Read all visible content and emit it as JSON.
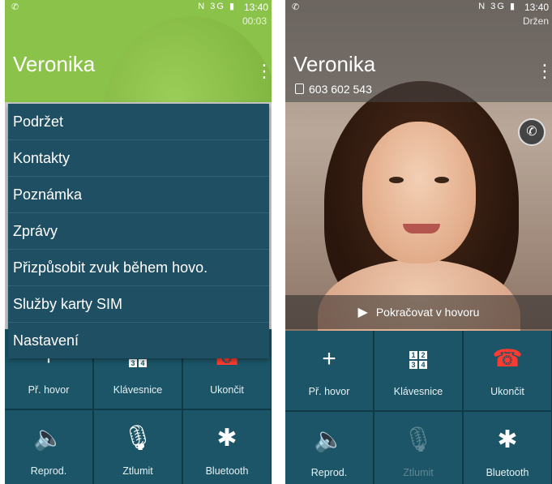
{
  "left": {
    "status_bar": {
      "time": "13:40",
      "network": "3G"
    },
    "call": {
      "duration": "00:03",
      "caller": "Veronika"
    },
    "menu": {
      "items": [
        "Podržet",
        "Kontakty",
        "Poznámka",
        "Zprávy",
        "Přizpůsobit zvuk během hovo.",
        "Služby karty SIM",
        "Nastavení"
      ]
    },
    "buttons": {
      "add_call": "Př. hovor",
      "keypad": "Klávesnice",
      "end": "Ukončit",
      "speaker": "Reprod.",
      "mute": "Ztlumit",
      "bluetooth": "Bluetooth"
    }
  },
  "right": {
    "status_bar": {
      "time": "13:40",
      "network": "3G"
    },
    "call": {
      "status": "Držen",
      "caller": "Veronika",
      "number": "603 602 543"
    },
    "resume_label": "Pokračovat v hovoru",
    "buttons": {
      "add_call": "Př. hovor",
      "keypad": "Klávesnice",
      "end": "Ukončit",
      "speaker": "Reprod.",
      "mute": "Ztlumit",
      "bluetooth": "Bluetooth"
    }
  },
  "keypad_digits": [
    "1",
    "2",
    "3",
    "4"
  ],
  "colors": {
    "header_green": "#8bc34a",
    "menu_bg": "#1f4f63",
    "button_bg": "#1b5567",
    "end_call_red": "#ff3b2f"
  }
}
